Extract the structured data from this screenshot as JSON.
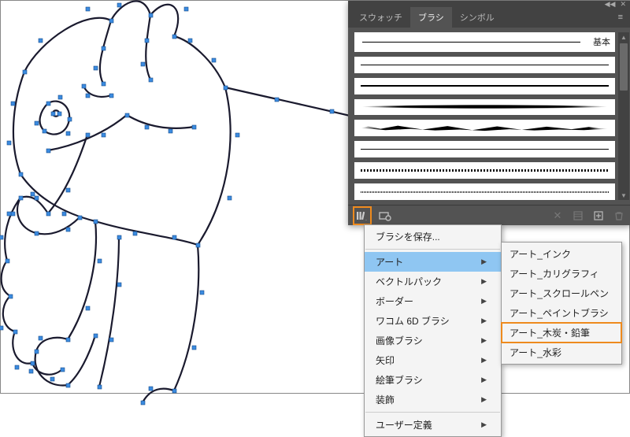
{
  "panel": {
    "tabs": [
      "スウォッチ",
      "ブラシ",
      "シンボル"
    ],
    "active_tab_index": 1,
    "basic_label": "基本",
    "footer_icons": {
      "library": "brush-library-icon",
      "libraries": "libraries-cloud-icon",
      "remove_stroke": "remove-brush-stroke-icon",
      "options": "brush-options-icon",
      "new": "new-brush-icon",
      "delete": "delete-brush-icon"
    }
  },
  "menu": {
    "save_label": "ブラシを保存...",
    "items": [
      {
        "label": "アート",
        "has_sub": true,
        "selected": true
      },
      {
        "label": "ベクトルパック",
        "has_sub": true
      },
      {
        "label": "ボーダー",
        "has_sub": true
      },
      {
        "label": "ワコム 6D ブラシ",
        "has_sub": true
      },
      {
        "label": "画像ブラシ",
        "has_sub": true
      },
      {
        "label": "矢印",
        "has_sub": true
      },
      {
        "label": "絵筆ブラシ",
        "has_sub": true
      },
      {
        "label": "装飾",
        "has_sub": true
      },
      {
        "label": "ユーザー定義",
        "has_sub": true
      }
    ]
  },
  "submenu": {
    "items": [
      {
        "label": "アート_インク"
      },
      {
        "label": "アート_カリグラフィ"
      },
      {
        "label": "アート_スクロールペン"
      },
      {
        "label": "アート_ペイントブラシ"
      },
      {
        "label": "アート_木炭・鉛筆",
        "highlighted": true
      },
      {
        "label": "アート_水彩"
      }
    ]
  }
}
